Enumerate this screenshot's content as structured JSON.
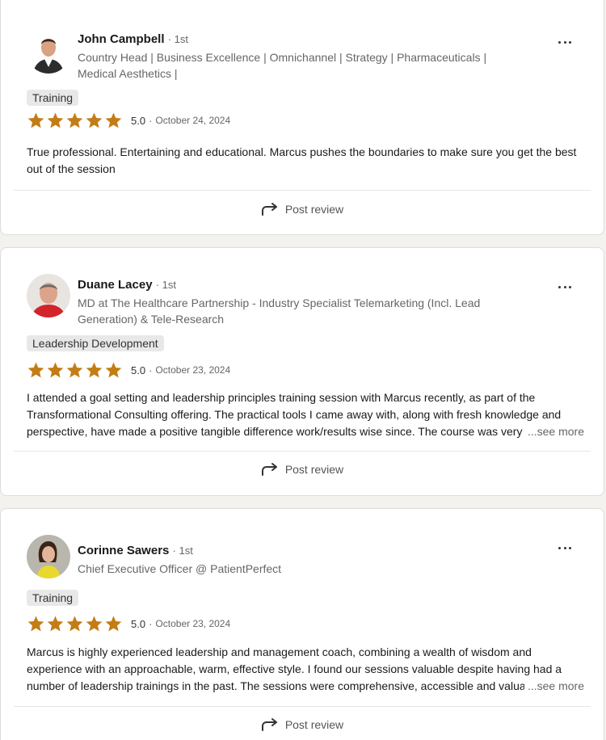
{
  "colors": {
    "star": "#c37d16",
    "text_muted": "#666666"
  },
  "reviews": [
    {
      "name": "John Campbell",
      "degree": "· 1st",
      "headline": "Country Head | Business Excellence | Omnichannel | Strategy | Pharmaceuticals | Medical Aesthetics |",
      "tag": "Training",
      "score": "5.0",
      "stars": 5,
      "date": "October 24, 2024",
      "text": "True professional. Entertaining and educational. Marcus pushes the boundaries to make sure you get the best out of the session",
      "see_more": "",
      "post_label": "Post review",
      "icons": {
        "more": "more-horizontal-icon",
        "share": "share-arrow-icon"
      }
    },
    {
      "name": "Duane Lacey",
      "degree": "· 1st",
      "headline": "MD at The Healthcare Partnership - Industry Specialist Telemarketing (Incl. Lead Generation) & Tele-Research",
      "tag": "Leadership Development",
      "score": "5.0",
      "stars": 5,
      "date": "October 23, 2024",
      "text": "I attended a goal setting and leadership principles training session with Marcus recently, as part of the Transformational Consulting offering. The practical tools I came away with, along with fresh knowledge and perspective, have made a positive tangible difference work/results wise since. The course was very pr",
      "see_more": "...see more",
      "post_label": "Post review",
      "icons": {
        "more": "more-horizontal-icon",
        "share": "share-arrow-icon"
      }
    },
    {
      "name": "Corinne Sawers",
      "degree": "· 1st",
      "headline": "Chief Executive Officer @ PatientPerfect",
      "tag": "Training",
      "score": "5.0",
      "stars": 5,
      "date": "October 23, 2024",
      "text": "Marcus is highly experienced leadership and management coach, combining a wealth of wisdom and experience with an approachable, warm, effective style. I found our sessions valuable despite having had a number of leadership trainings in the past. The sessions were comprehensive, accessible and valuable",
      "see_more": "...see more",
      "post_label": "Post review",
      "icons": {
        "more": "more-horizontal-icon",
        "share": "share-arrow-icon"
      }
    }
  ]
}
